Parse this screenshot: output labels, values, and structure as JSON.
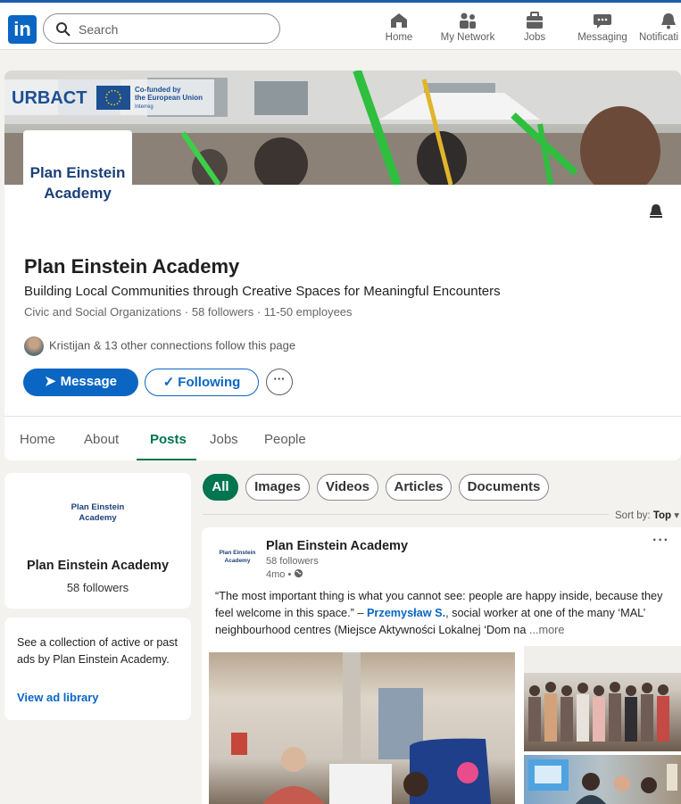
{
  "topbar": {
    "logo_text": "in",
    "search_placeholder": "Search",
    "nav": [
      {
        "label": "Home",
        "icon": "home-icon"
      },
      {
        "label": "My Network",
        "icon": "network-icon"
      },
      {
        "label": "Jobs",
        "icon": "briefcase-icon"
      },
      {
        "label": "Messaging",
        "icon": "messaging-icon"
      },
      {
        "label": "Notificati",
        "icon": "bell-icon"
      }
    ]
  },
  "banner": {
    "logo_text": "URBACT",
    "eu_text_line1": "Co-funded by",
    "eu_text_line2": "the European Union",
    "eu_text_line3": "Interreg"
  },
  "company": {
    "logo_line1": "Plan Einstein",
    "logo_line2": "Academy",
    "name": "Plan Einstein Academy",
    "tagline": "Building Local Communities through Creative Spaces for Meaningful Encounters",
    "meta": "Civic and Social Organizations · 58 followers · 11-50 employees",
    "connections": "Kristijan & 13 other connections follow this page"
  },
  "actions": {
    "message": "Message",
    "following": "Following",
    "more": "···"
  },
  "tabs": [
    "Home",
    "About",
    "Posts",
    "Jobs",
    "People"
  ],
  "sidebar": {
    "logo_line1": "Plan Einstein",
    "logo_line2": "Academy",
    "name": "Plan Einstein Academy",
    "followers": "58 followers",
    "ads_text": "See a collection of active or past ads by Plan Einstein Academy.",
    "ads_link": "View ad library"
  },
  "filters": [
    "All",
    "Images",
    "Videos",
    "Articles",
    "Documents"
  ],
  "sort": {
    "label": "Sort by:",
    "value": "Top"
  },
  "post": {
    "logo_line1": "Plan Einstein",
    "logo_line2": "Academy",
    "author": "Plan Einstein Academy",
    "followers": "58 followers",
    "time": "4mo •",
    "text_before": "“The most important thing is what you cannot see: people are happy inside, because they feel welcome in this space.” – ",
    "mention": "Przemysław S.",
    "text_after": ", social worker at one of the many ‘MAL’ neighbourhood centres  (Miejsce Aktywności Lokalnej ‘Dom na  ",
    "more": "...more"
  }
}
